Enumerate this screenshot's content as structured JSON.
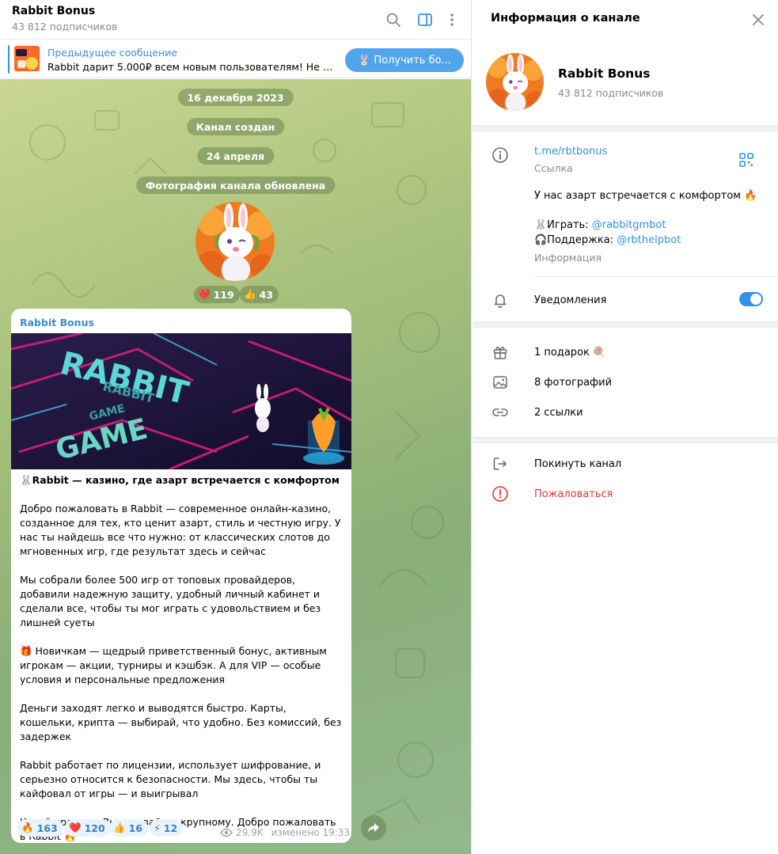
{
  "chat": {
    "title": "Rabbit Bonus",
    "subscribers": "43 812 подписчиков",
    "pinned": {
      "title": "Предыдущее сообщение",
      "text": "Rabbit дарит 5.000₽ всем новым пользователям!  Не про...",
      "button": "🐰 Получить бо..."
    },
    "services": [
      "16 декабря 2023",
      "Канал создан",
      "24 апреля",
      "Фотография канала обновлена"
    ],
    "photo_reactions": [
      {
        "emoji": "❤️",
        "count": "119"
      },
      {
        "emoji": "👍",
        "count": "43"
      }
    ],
    "message": {
      "author": "Rabbit Bonus",
      "banner_text": {
        "line1": "RABBIT",
        "line2": "RABBIT",
        "line3": "GAME",
        "line4": "GAME"
      },
      "paragraphs": [
        "🐰Rabbit — казино, где азарт встречается с комфортом",
        "",
        "Добро пожаловать в Rabbit — современное онлайн-казино, созданное для тех, кто ценит азарт, стиль и честную игру. У нас ты найдешь все что нужно: от классических слотов до мгновенных игр, где результат здесь и сейчас",
        "",
        "Мы собрали более 500 игр от топовых провайдеров, добавили надежную защиту, удобный личный кабинет и сделали все, чтобы ты мог играть с удовольствием и без лишней суеты",
        "",
        "🎁 Новичкам — щедрый приветственный бонус, активным игрокам — акции, турниры и кэшбэк. А для VIP — особые условия и персональные предложения",
        "",
        "Деньги заходят легко и выводятся быстро. Карты, кошельки, крипта — выбирай, что удобно. Без комиссий, без задержек",
        "",
        "Rabbit работает по лицензии, использует шифрование, и серьезно относится к безопасности. Мы здесь, чтобы ты кайфовал от игры — и выигрывал",
        "",
        "Играй красиво. Выигрывай по-крупному. Добро пожаловать в Rabbit 🔥"
      ],
      "reactions": [
        {
          "emoji": "🔥",
          "count": "163"
        },
        {
          "emoji": "❤️",
          "count": "120"
        },
        {
          "emoji": "👍",
          "count": "16"
        },
        {
          "emoji": "⚡",
          "count": "12"
        }
      ],
      "views": "29.9K",
      "edited": "изменено 19:33"
    }
  },
  "info": {
    "title": "Информация о канале",
    "name": "Rabbit Bonus",
    "subscribers": "43 812 подписчиков",
    "link": "t.me/rbtbonus",
    "link_caption": "Ссылка",
    "description_line1": "У нас азарт встречается с комфортом 🔥",
    "play_prefix": "🐰Играть: ",
    "play_handle": "@rabbitgmbot",
    "support_prefix": "🎧Поддержка: ",
    "support_handle": "@rbthelpbot",
    "description_caption": "Информация",
    "notifications": "Уведомления",
    "notifications_on": true,
    "gifts": "1 подарок 🍭",
    "photos": "8 фотографий",
    "links": "2 ссылки",
    "leave": "Покинуть канал",
    "report": "Пожаловаться"
  },
  "colors": {
    "accent": "#3390ec",
    "danger": "#e53935",
    "chat_bg": "#a6c07c"
  }
}
